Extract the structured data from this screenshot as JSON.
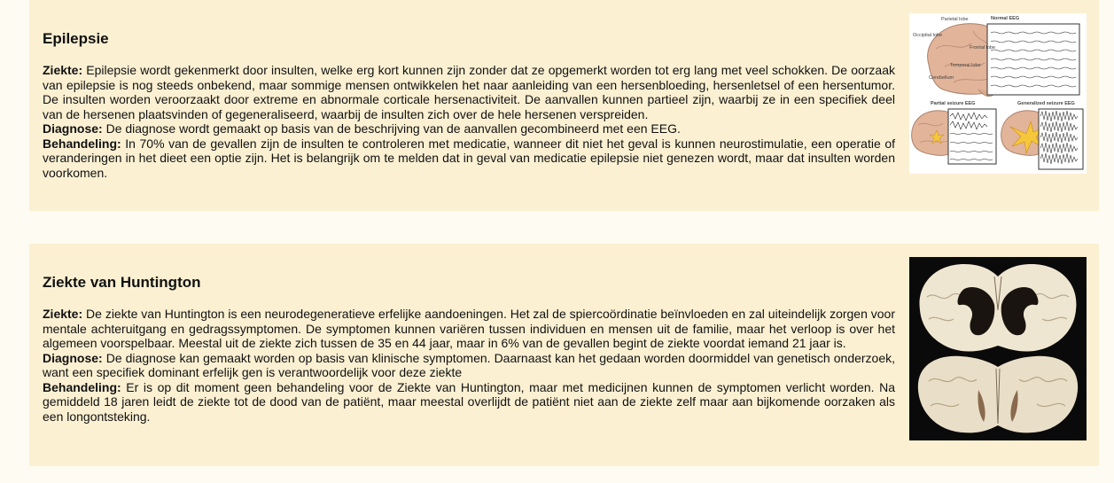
{
  "sections": [
    {
      "title": "Epilepsie",
      "paragraphs": [
        {
          "label": "Ziekte:",
          "text": "Epilepsie wordt gekenmerkt door insulten, welke erg kort kunnen zijn zonder dat ze opgemerkt worden tot erg lang met veel schokken. De oorzaak van epilepsie is nog steeds onbekend, maar sommige mensen ontwikkelen het naar aanleiding van een hersenbloeding, hersenletsel of een hersentumor. De insulten worden veroorzaakt door extreme en abnormale corticale hersenactiviteit. De aanvallen kunnen partieel zijn, waarbij ze in een specifiek deel van de hersenen plaatsvinden of gegeneraliseerd, waarbij de insulten zich over de hele hersenen verspreiden."
        },
        {
          "label": "Diagnose:",
          "text": "De diagnose wordt gemaakt op basis van de beschrijving van de aanvallen gecombineerd met een EEG."
        },
        {
          "label": "Behandeling:",
          "text": "In 70% van de gevallen zijn de insulten te controleren met medicatie, wanneer dit niet het geval is kunnen neurostimulatie, een operatie of veranderingen in het dieet een optie zijn. Het is belangrijk om te melden dat in geval van medicatie epilepsie niet genezen wordt, maar dat insulten worden voorkomen."
        }
      ],
      "figure_labels": {
        "parietal": "Parietal lobe",
        "normal_eeg": "Normal EEG",
        "occipital": "Occipital lobe",
        "frontal": "Frontal lobe",
        "temporal": "Temporal lobe",
        "cerebellum": "Cerebellum",
        "partial": "Partial seizure EEG",
        "generalized": "Generalized seizure EEG"
      }
    },
    {
      "title": "Ziekte van Huntington",
      "paragraphs": [
        {
          "label": "Ziekte:",
          "text": "De ziekte van Huntington is een neurodegeneratieve erfelijke aandoeningen. Het zal de spiercoördinatie beïnvloeden en zal uiteindelijk zorgen voor mentale achteruitgang en gedragssymptomen. De symptomen kunnen variëren tussen individuen en mensen uit de familie, maar het verloop is over het algemeen voorspelbaar. Meestal uit de ziekte zich tussen de 35 en 44 jaar, maar in 6% van de gevallen begint de ziekte voordat iemand 21 jaar is."
        },
        {
          "label": "Diagnose:",
          "text": "De diagnose kan gemaakt worden op basis van klinische symptomen. Daarnaast kan het gedaan worden doormiddel van genetisch onderzoek, want een specifiek dominant erfelijk gen is verantwoordelijk voor deze ziekte"
        },
        {
          "label": "Behandeling:",
          "text": "Er is op dit moment geen behandeling voor de Ziekte van Huntington, maar met medicijnen kunnen de symptomen verlicht worden. Na gemiddeld 18 jaren leidt de ziekte tot de dood van de patiënt, maar meestal overlijdt de patiënt niet aan de ziekte zelf maar aan bijkomende oorzaken als een longontsteking."
        }
      ]
    }
  ]
}
